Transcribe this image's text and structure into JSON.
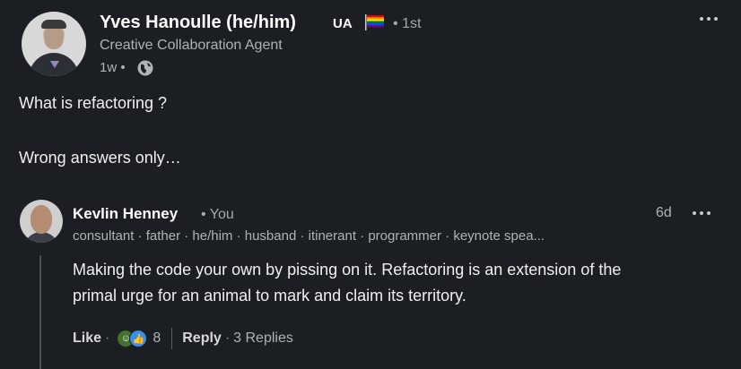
{
  "post": {
    "author_name": "Yves Hanoulle (he/him)",
    "author_badge": "UA",
    "degree": "• 1st",
    "headline": "Creative Collaboration Agent",
    "time": "1w •",
    "visibility_icon": "globe-icon",
    "more_icon": "more-horizontal-icon",
    "body_lines": [
      "What is refactoring ?",
      "Wrong answers only…"
    ]
  },
  "comment": {
    "author_name": "Kevlin Henney",
    "you_label": "• You",
    "time": "6d",
    "headline": "consultant · father · he/him · husband · itinerant · programmer · keynote spea...",
    "text_lines": [
      "Making the code your own by pissing on it. Refactoring is an extension of the",
      "primal urge for an animal to mark and claim its territory."
    ],
    "like_label": "Like",
    "dot": "·",
    "reaction_count": "8",
    "reply_label": "Reply",
    "replies_label": "3 Replies"
  },
  "colors": {
    "background": "#1b1f23",
    "like_blue": "#378fe9",
    "funny_teal": "#44712e"
  }
}
